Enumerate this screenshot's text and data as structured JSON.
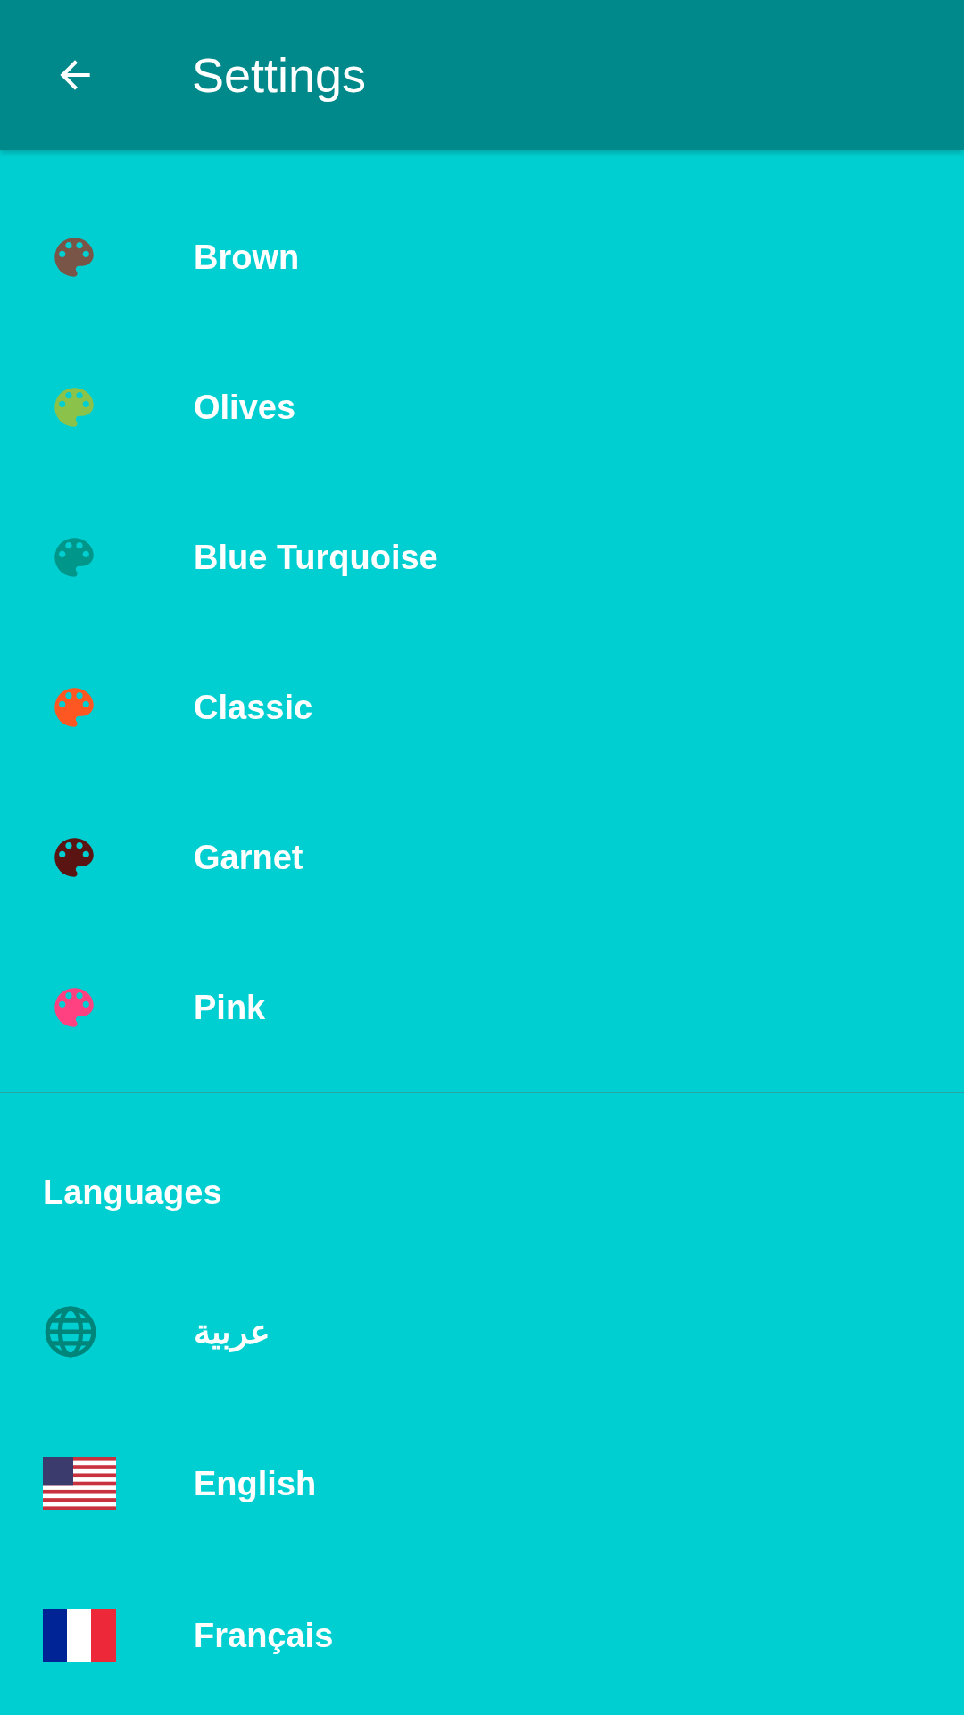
{
  "app_bar": {
    "title": "Settings"
  },
  "themes": [
    {
      "label": "Brown",
      "color": "#795548"
    },
    {
      "label": "Olives",
      "color": "#8bc34a"
    },
    {
      "label": "Blue Turquoise",
      "color": "#00968a"
    },
    {
      "label": "Classic",
      "color": "#ff5722"
    },
    {
      "label": "Garnet",
      "color": "#5a1512"
    },
    {
      "label": "Pink",
      "color": "#ff4081"
    }
  ],
  "languages_section": {
    "title": "Languages",
    "items": [
      {
        "label": "عربية",
        "kind": "globe"
      },
      {
        "label": "English",
        "kind": "flag-us"
      },
      {
        "label": "Français",
        "kind": "flag-fr"
      }
    ]
  }
}
